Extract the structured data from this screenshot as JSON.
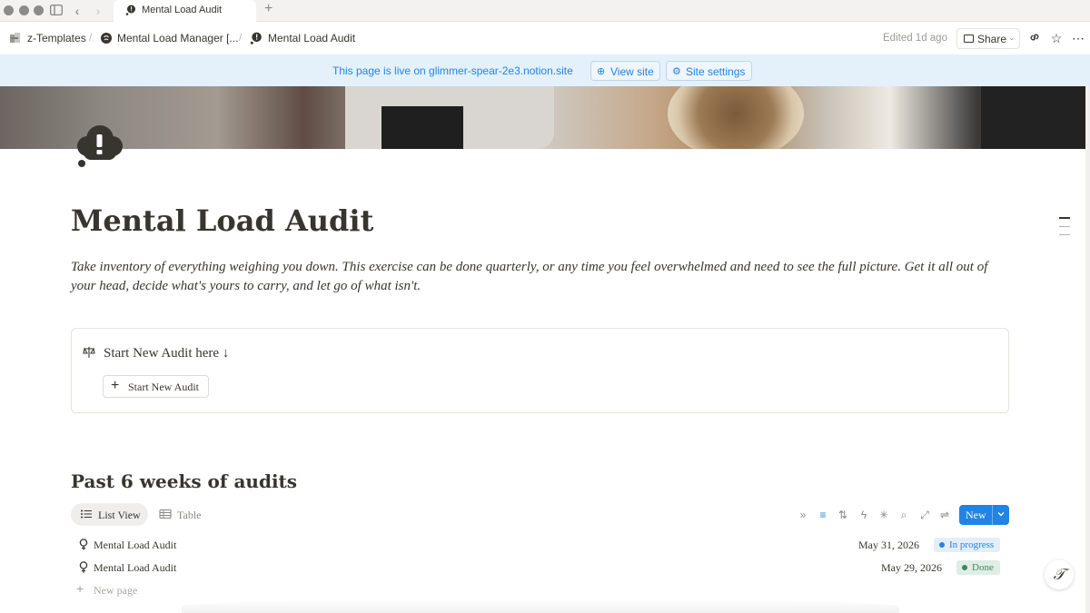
{
  "browser": {
    "tab_title": "Mental Load Audit",
    "new_tab_symbol": "+"
  },
  "breadcrumb": {
    "items": [
      "z-Templates",
      "Mental Load Manager [...",
      "Mental Load Audit"
    ],
    "separator": "/"
  },
  "topbar": {
    "edited": "Edited 1d ago",
    "share_label": "Share"
  },
  "banner": {
    "text": "This page is live on glimmer-spear-2e3.notion.site",
    "view_site": "View site",
    "site_settings": "Site settings"
  },
  "page": {
    "title": "Mental Load Audit",
    "description": "Take inventory of everything weighing you down. This exercise can be done quarterly, or any time you feel overwhelmed and need to see the full picture. Get it all out of your head, decide what's yours to carry, and let go of what isn't."
  },
  "callout": {
    "text": "Start New Audit here ↓",
    "button_label": "Start New Audit"
  },
  "database": {
    "heading": "Past 6 weeks of audits",
    "views": [
      {
        "label": "List View",
        "active": true
      },
      {
        "label": "Table",
        "active": false
      }
    ],
    "new_button": "New",
    "rows": [
      {
        "title": "Mental Load Audit",
        "date": "May 31, 2026",
        "status": "In progress",
        "status_color": "#2383e2",
        "status_bg": "#e4eefa"
      },
      {
        "title": "Mental Load Audit",
        "date": "May 29, 2026",
        "status": "Done",
        "status_color": "#448361",
        "status_bg": "#dfeee4"
      }
    ],
    "new_page_label": "New page"
  },
  "colors": {
    "accent": "#2383e2",
    "text": "#37352f",
    "banner_bg": "#e5f1fa"
  },
  "icons": [
    "sidebar-toggle-icon",
    "back-icon",
    "forward-icon",
    "link-icon",
    "star-icon",
    "more-icon",
    "globe-icon",
    "gear-icon",
    "thought-bubble-icon",
    "scale-icon",
    "list-icon",
    "table-icon",
    "filter-icon",
    "sort-icon",
    "lightning-icon",
    "sparkle-icon",
    "search-icon",
    "expand-icon",
    "settings-sliders-icon",
    "chevron-down-icon",
    "page-icon",
    "help-icon"
  ]
}
